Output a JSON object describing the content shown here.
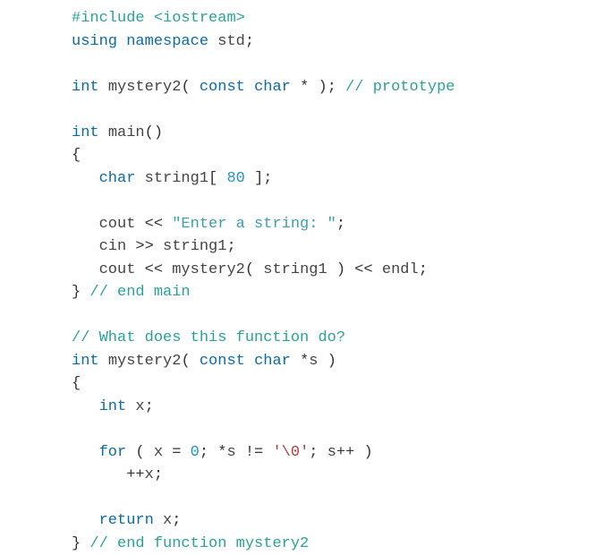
{
  "code": {
    "preproc_hash": "#include",
    "lt": "<",
    "gt": ">",
    "iostream": "iostream",
    "using": "using",
    "namespace": "namespace",
    "std": "std",
    "semi": ";",
    "int": "int",
    "mystery2": "mystery2",
    "lparen": "(",
    "rparen": ")",
    "const": "const",
    "char": "char",
    "star": "*",
    "cmt_prototype": "// prototype",
    "main": "main",
    "lbrace": "{",
    "rbrace": "}",
    "string1": "string1",
    "lbr": "[",
    "rbr": "]",
    "eighty": "80",
    "cout": "cout",
    "ltlt": "<<",
    "gtgt": ">>",
    "str_prompt": "\"Enter a string: \"",
    "cin": "cin",
    "endl": "endl",
    "cmt_endmain": "// end main",
    "cmt_whatdoes": "// What does this function do?",
    "s": "s",
    "x": "x",
    "for": "for",
    "eq": "=",
    "zero": "0",
    "neq": "!=",
    "nulchar": "'\\0'",
    "plusplus": "++",
    "return": "return",
    "cmt_endfunc": "// end function mystery2"
  }
}
